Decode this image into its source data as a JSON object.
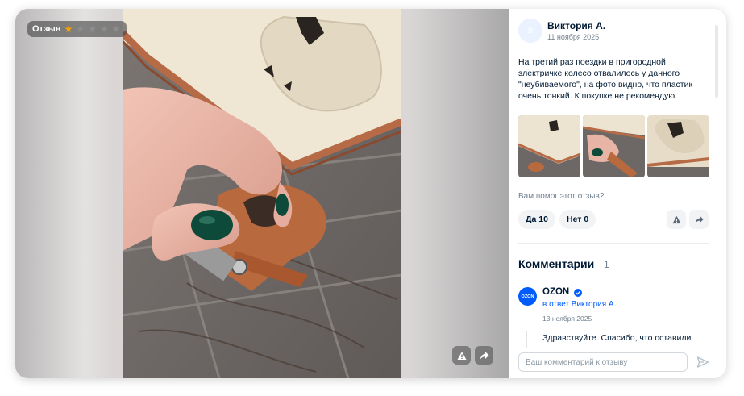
{
  "media": {
    "tag_label": "Отзыв",
    "rating": {
      "value": 1,
      "max": 5
    },
    "icons": [
      "report-icon",
      "share-icon"
    ]
  },
  "review": {
    "author": "Виктория А.",
    "avatar_letter": "В",
    "date": "11 ноября 2025",
    "text": "На третий раз поездки в пригородной электричке колесо отвалилось у данного \"неубиваемого\", на фото видно, что пластик очень тонкий. К покупке не рекомендую.",
    "thumbnails_count": 3,
    "helpful_question": "Вам помог этот отзыв?",
    "yes_label": "Да 10",
    "no_label": "Нет 0"
  },
  "comments": {
    "title": "Комментарии",
    "count": "1",
    "items": [
      {
        "logo_text": "OZON",
        "author": "OZON",
        "reply_to": "в ответ Виктория А.",
        "date": "13 ноября 2025",
        "text": "Здравствуйте. Спасибо, что оставили"
      }
    ]
  },
  "composer": {
    "placeholder": "Ваш комментарий к отзыву"
  },
  "colors": {
    "accent": "#005bff",
    "star_active": "#f6a400",
    "text_primary": "#001a34",
    "text_secondary": "#707f8d",
    "chip_bg": "#f2f3f5"
  }
}
